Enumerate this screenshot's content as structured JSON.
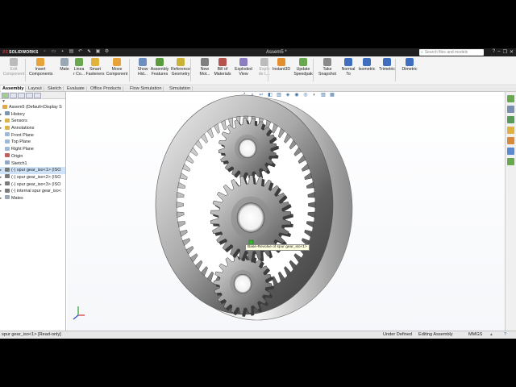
{
  "app": {
    "logo_text": "SOLIDWORKS",
    "document_title": "Assem5 *",
    "search_placeholder": "Search files and models"
  },
  "ribbon": {
    "buttons": [
      {
        "label": "Edit\nComponent",
        "icon": "edit-component-icon",
        "color": "#bbbbbb",
        "disabled": true
      },
      {
        "label": "Insert\nComponents",
        "icon": "insert-components-icon",
        "color": "#e8a23a"
      },
      {
        "label": "Mate",
        "icon": "mate-icon",
        "color": "#9aa7b5"
      },
      {
        "label": "Linea\nr Co...",
        "icon": "linear-pattern-icon",
        "color": "#6aa84f"
      },
      {
        "label": "Smart\nFasteners",
        "icon": "smart-fasteners-icon",
        "color": "#e2b33c"
      },
      {
        "label": "Move\nComponent",
        "icon": "move-component-icon",
        "color": "#e8a23a"
      },
      {
        "label": "Show\nHid...",
        "icon": "show-hide-icon",
        "color": "#6d8fbf"
      },
      {
        "label": "Assembly\nFeatures",
        "icon": "assembly-features-icon",
        "color": "#5b9b3f"
      },
      {
        "label": "Reference\nGeometry",
        "icon": "reference-geometry-icon",
        "color": "#c8b237"
      },
      {
        "label": "New\nMot...",
        "icon": "new-motion-study-icon",
        "color": "#7f7f7f"
      },
      {
        "label": "Bill of\nMaterials",
        "icon": "bill-of-materials-icon",
        "color": "#b5534c"
      },
      {
        "label": "Exploded\nView",
        "icon": "exploded-view-icon",
        "color": "#8e7cc3"
      },
      {
        "label": "Explo\nde L...",
        "icon": "explode-line-icon",
        "color": "#bbbbbb",
        "disabled": true
      },
      {
        "label": "Instant3D",
        "icon": "instant3d-icon",
        "color": "#e28f2d"
      },
      {
        "label": "Update\nSpeedpak",
        "icon": "update-speedpak-icon",
        "color": "#6aa84f"
      },
      {
        "label": "Take\nSnapshot",
        "icon": "take-snapshot-icon",
        "color": "#8a8a8a"
      },
      {
        "label": "Normal\nTo",
        "icon": "normal-to-icon",
        "color": "#3f6ebf"
      },
      {
        "label": "Isometric",
        "icon": "isometric-icon",
        "color": "#3f6ebf"
      },
      {
        "label": "Trimetric",
        "icon": "trimetric-icon",
        "color": "#3f6ebf"
      },
      {
        "label": "Dimetric",
        "icon": "dimetric-icon",
        "color": "#3f6ebf"
      }
    ]
  },
  "tabs": [
    "Assembly",
    "Layout",
    "Sketch",
    "Evaluate",
    "Office Products",
    "Flow Simulation",
    "Simulation"
  ],
  "feature_tree": {
    "root": "Assem5  (Default<Display S",
    "items": [
      {
        "label": "History",
        "icon": "history-icon",
        "color": "#7d93b2"
      },
      {
        "label": "Sensors",
        "icon": "sensors-icon",
        "color": "#d9b44a"
      },
      {
        "label": "Annotations",
        "icon": "annotations-icon",
        "color": "#d9b44a"
      },
      {
        "label": "Front Plane",
        "icon": "plane-icon",
        "color": "#9fb8d6"
      },
      {
        "label": "Top Plane",
        "icon": "plane-icon",
        "color": "#9fb8d6"
      },
      {
        "label": "Right Plane",
        "icon": "plane-icon",
        "color": "#9fb8d6"
      },
      {
        "label": "Origin",
        "icon": "origin-icon",
        "color": "#c06060"
      },
      {
        "label": "Sketch1",
        "icon": "sketch-icon",
        "color": "#8fa8c8"
      },
      {
        "label": "(-) spur gear_iso<1> (ISO",
        "icon": "part-icon",
        "color": "#7a7a7a"
      },
      {
        "label": "(-) spur gear_iso<2> (ISO",
        "icon": "part-icon",
        "color": "#7a7a7a"
      },
      {
        "label": "(-) spur gear_iso<3> (ISO",
        "icon": "part-icon",
        "color": "#7a7a7a"
      },
      {
        "label": "(-) internal spur gear_iso<",
        "icon": "part-icon",
        "color": "#7a7a7a"
      },
      {
        "label": "Mates",
        "icon": "mates-icon",
        "color": "#9aa7b5"
      }
    ]
  },
  "viewport": {
    "tooltip": "Base-Revolve of spur gear_iso<1>"
  },
  "statusbar": {
    "selection": "spur gear_iso<1> [Read-only]",
    "state": "Under Defined",
    "mode": "Editing Assembly",
    "units": "MMGS"
  }
}
